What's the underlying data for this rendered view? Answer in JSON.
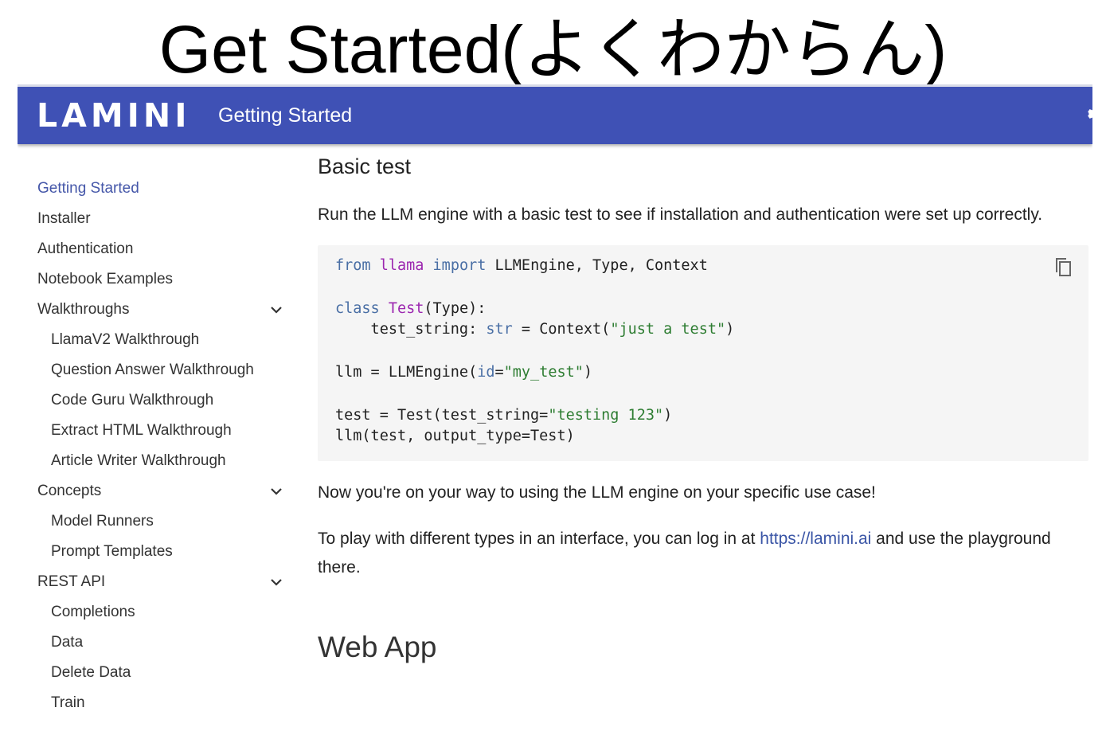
{
  "slide": {
    "title": "Get Started(よくわからん)"
  },
  "header": {
    "logo": "LAMINI",
    "site_title": "Getting Started"
  },
  "sidebar": {
    "items": [
      {
        "label": "Getting Started",
        "active": true,
        "level": 0
      },
      {
        "label": "Installer",
        "level": 0
      },
      {
        "label": "Authentication",
        "level": 0
      },
      {
        "label": "Notebook Examples",
        "level": 0
      },
      {
        "label": "Walkthroughs",
        "level": 0,
        "expanded": true
      },
      {
        "label": "LlamaV2 Walkthrough",
        "level": 1
      },
      {
        "label": "Question Answer Walkthrough",
        "level": 1
      },
      {
        "label": "Code Guru Walkthrough",
        "level": 1
      },
      {
        "label": "Extract HTML Walkthrough",
        "level": 1
      },
      {
        "label": "Article Writer Walkthrough",
        "level": 1
      },
      {
        "label": "Concepts",
        "level": 0,
        "expanded": true
      },
      {
        "label": "Model Runners",
        "level": 1
      },
      {
        "label": "Prompt Templates",
        "level": 1
      },
      {
        "label": "REST API",
        "level": 0,
        "expanded": true
      },
      {
        "label": "Completions",
        "level": 1
      },
      {
        "label": "Data",
        "level": 1
      },
      {
        "label": "Delete Data",
        "level": 1
      },
      {
        "label": "Train",
        "level": 1
      }
    ]
  },
  "content": {
    "heading": "Basic test",
    "intro": "Run the LLM engine with a basic test to see if installation and authentication were set up correctly.",
    "code": {
      "l1_kw1": "from",
      "l1_mod": "llama",
      "l1_kw2": "import",
      "l1_rest": "LLMEngine, Type, Context",
      "l2_kw": "class",
      "l2_name": "Test",
      "l2_rest": "(Type):",
      "l3_a": "    test_string: ",
      "l3_type": "str",
      "l3_b": " = Context(",
      "l3_str": "\"just a test\"",
      "l3_c": ")",
      "l4_a": "llm = LLMEngine(",
      "l4_kw": "id",
      "l4_b": "=",
      "l4_str": "\"my_test\"",
      "l4_c": ")",
      "l5_a": "test = Test(test_string=",
      "l5_str": "\"testing 123\"",
      "l5_c": ")",
      "l6": "llm(test, output_type=Test)"
    },
    "after_code": "Now you're on your way to using the LLM engine on your specific use case!",
    "play_before": "To play with different types in an interface, you can log in at ",
    "play_link": "https://lamini.ai",
    "play_after": " and use the playground there.",
    "next_heading": "Web App"
  },
  "colors": {
    "header_bg": "#3f51b5",
    "active_nav": "#4557a9",
    "link": "#3a55a6",
    "code_bg": "#f5f5f5"
  }
}
